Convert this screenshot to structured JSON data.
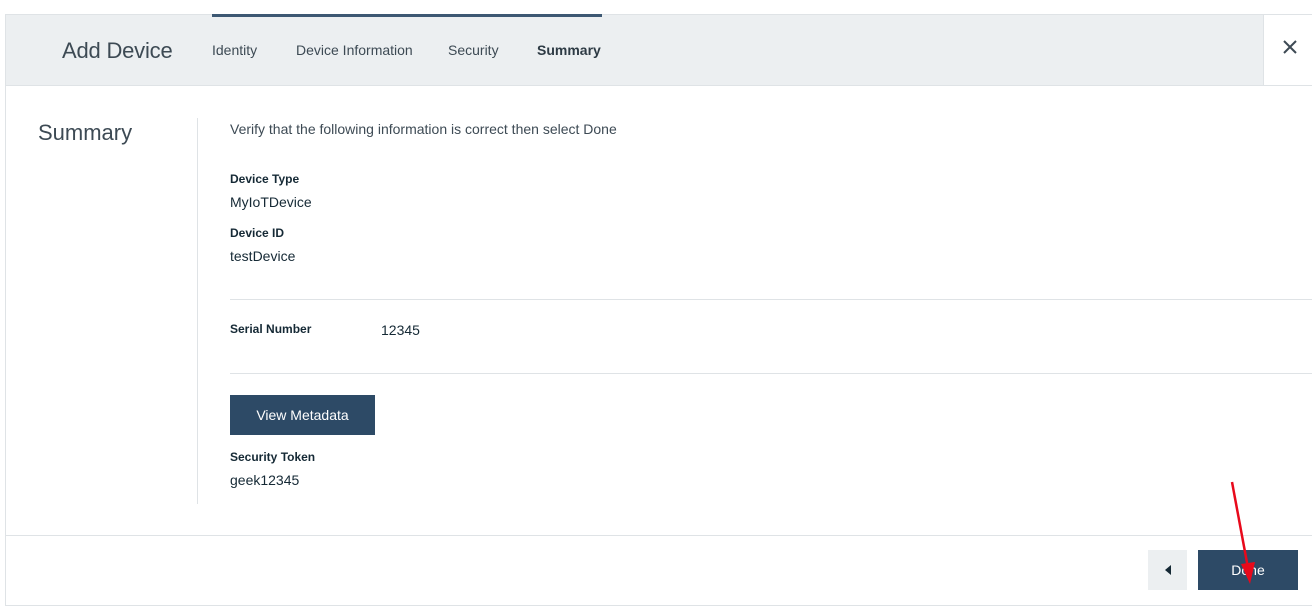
{
  "header": {
    "title": "Add Device",
    "tabs": [
      {
        "label": "Identity"
      },
      {
        "label": "Device Information"
      },
      {
        "label": "Security"
      },
      {
        "label": "Summary"
      }
    ],
    "close_icon": "close-icon"
  },
  "summary": {
    "title": "Summary",
    "intro": "Verify that the following information is correct then select Done",
    "device_type_label": "Device Type",
    "device_type_value": "MyIoTDevice",
    "device_id_label": "Device ID",
    "device_id_value": "testDevice",
    "serial_number_label": "Serial Number",
    "serial_number_value": "12345",
    "view_metadata_label": "View Metadata",
    "security_token_label": "Security Token",
    "security_token_value": "geek12345"
  },
  "footer": {
    "back_icon": "caret-left-icon",
    "done_label": "Done"
  },
  "colors": {
    "header_bg": "#eceff1",
    "primary": "#2d4a66",
    "annotation_arrow": "#e8091b"
  }
}
